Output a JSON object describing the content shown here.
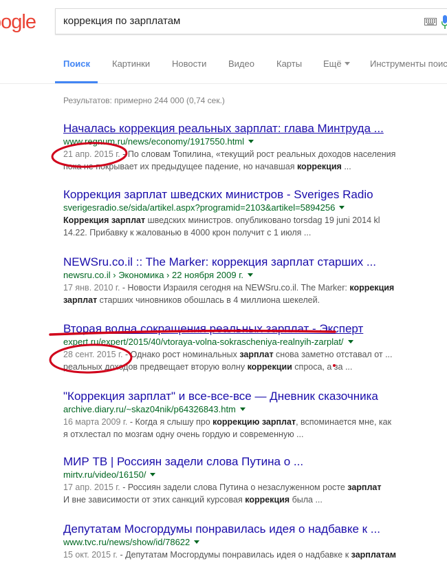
{
  "logo": {
    "text": "oogle"
  },
  "search": {
    "query": "коррекция по зарплатам"
  },
  "tabs": [
    {
      "label": "Поиск"
    },
    {
      "label": "Картинки"
    },
    {
      "label": "Новости"
    },
    {
      "label": "Видео"
    },
    {
      "label": "Карты"
    },
    {
      "label": "Ещё"
    },
    {
      "label": "Инструменты поис"
    }
  ],
  "stats": "Результатов: примерно 244 000 (0,74 сек.)",
  "results": [
    {
      "title": "Началась коррекция реальных зарплат: глава Минтруда ...",
      "url": "www.regnum.ru/news/economy/1917550.html",
      "date": "21 апр. 2015 г.",
      "snippet1": " - По словам Топилина, «текущий рост реальных доходов населения",
      "snippet2a": "пока не покрывает их предыдущее падение, но начавшая ",
      "snippet2b": "коррекция",
      "snippet2c": " ..."
    },
    {
      "title": "Коррекция зарплат шведских министров - Sveriges Radio",
      "url": "sverigesradio.se/sida/artikel.aspx?programid=2103&artikel=5894256",
      "snippet1a": "Коррекция зарплат",
      "snippet1b": " шведских министров. опубликовано torsdag 19 juni 2014 kl",
      "snippet2": "14.22. Прибавку к жалованью в 4000 крон получит с 1 июля ..."
    },
    {
      "title": "NEWSru.co.il :: The Marker: коррекция зарплат старших ...",
      "url": "newsru.co.il",
      "crumb1": "Экономика",
      "crumb2": "22 ноября 2009 г.",
      "date": "17 янв. 2010 г.",
      "snippet1a": " - Новости Израиля сегодня на NEWSru.co.il. The Marker: ",
      "snippet1b": "коррекция",
      "snippet2a": "зарплат",
      "snippet2b": " старших чиновников обошлась в 4 миллиона шекелей."
    },
    {
      "title": "Вторая волна сокращения реальных зарплат - Эксперт",
      "url": "expert.ru/expert/2015/40/vtoraya-volna-sokrascheniya-realnyih-zarplat/",
      "date": "28 сент. 2015 г.",
      "snippet1a": " - Однако рост номинальных ",
      "snippet1b": "зарплат",
      "snippet1c": " снова заметно отставал от ...",
      "snippet2a": "реальных доходов предвещает вторую волну ",
      "snippet2b": "коррекции",
      "snippet2c": " спроса, а за ..."
    },
    {
      "title": "\"Коррекция зарплат\" и все-все-все — Дневник сказочника",
      "url": "archive.diary.ru/~skaz04nik/p64326843.htm",
      "date": "16 марта 2009 г.",
      "snippet1a": " - Когда я слышу про ",
      "snippet1b": "коррекцию зарплат",
      "snippet1c": ", вспоминается мне, как",
      "snippet2": "я отхлестал по мозгам одну очень гордую и современную ..."
    },
    {
      "title": "МИР ТВ | Россиян задели слова Путина о ...",
      "url": "mirtv.ru/video/16150/",
      "date": "17 апр. 2015 г.",
      "snippet1a": " - Россиян задели слова Путина о незаслуженном росте ",
      "snippet1b": "зарплат",
      "snippet2a": "И вне зависимости от этих санкций курсовая ",
      "snippet2b": "коррекция",
      "snippet2c": " была ..."
    },
    {
      "title": "Депутатам Мосгордумы понравилась идея о надбавке к ...",
      "url": "www.tvc.ru/news/show/id/78622",
      "date": "15 окт. 2015 г.",
      "snippet1a": " - Депутатам Мосгордумы понравилась идея о надбавке к ",
      "snippet1b": "зарплатам"
    }
  ],
  "colors": {
    "accent": "#4285f4",
    "link": "#1a0dab",
    "url": "#006621",
    "annotation": "#d0021b"
  }
}
